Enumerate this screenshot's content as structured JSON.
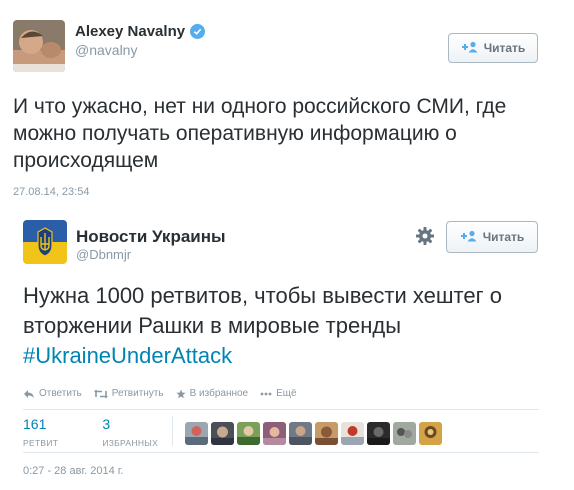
{
  "tweet1": {
    "author_name": "Alexey Navalny",
    "author_handle": "@navalny",
    "follow_label": "Читать",
    "text": "И что ужасно, нет ни одного российского СМИ, где можно получать оперативную информацию о происходящем",
    "timestamp": "27.08.14, 23:54",
    "icons": {
      "verified": "verified-badge-icon",
      "follow": "add-user-icon"
    }
  },
  "tweet2": {
    "author_name": "Новости Украины",
    "author_handle": "@Dbnmjr",
    "follow_label": "Читать",
    "text_main": "Нужна 1000 ретвитов, чтобы вывести хештег о вторжении Рашки в мировые тренды ",
    "hashtag": "#UkraineUnderAttack",
    "actions": {
      "reply": "Ответить",
      "retweet": "Ретвитнуть",
      "favorite": "В избранное",
      "more": "Ещё"
    },
    "stats": {
      "retweets_count": "161",
      "retweets_label": "РЕТВИТ",
      "favorites_count": "3",
      "favorites_label": "ИЗБРАННЫХ"
    },
    "timestamp": "0:27 - 28 авг. 2014 г.",
    "icons": {
      "settings": "gear-icon",
      "follow": "add-user-icon"
    }
  },
  "colors": {
    "link": "#0084b4",
    "muted": "#8899a6",
    "text": "#292f33",
    "verified": "#55acee"
  }
}
